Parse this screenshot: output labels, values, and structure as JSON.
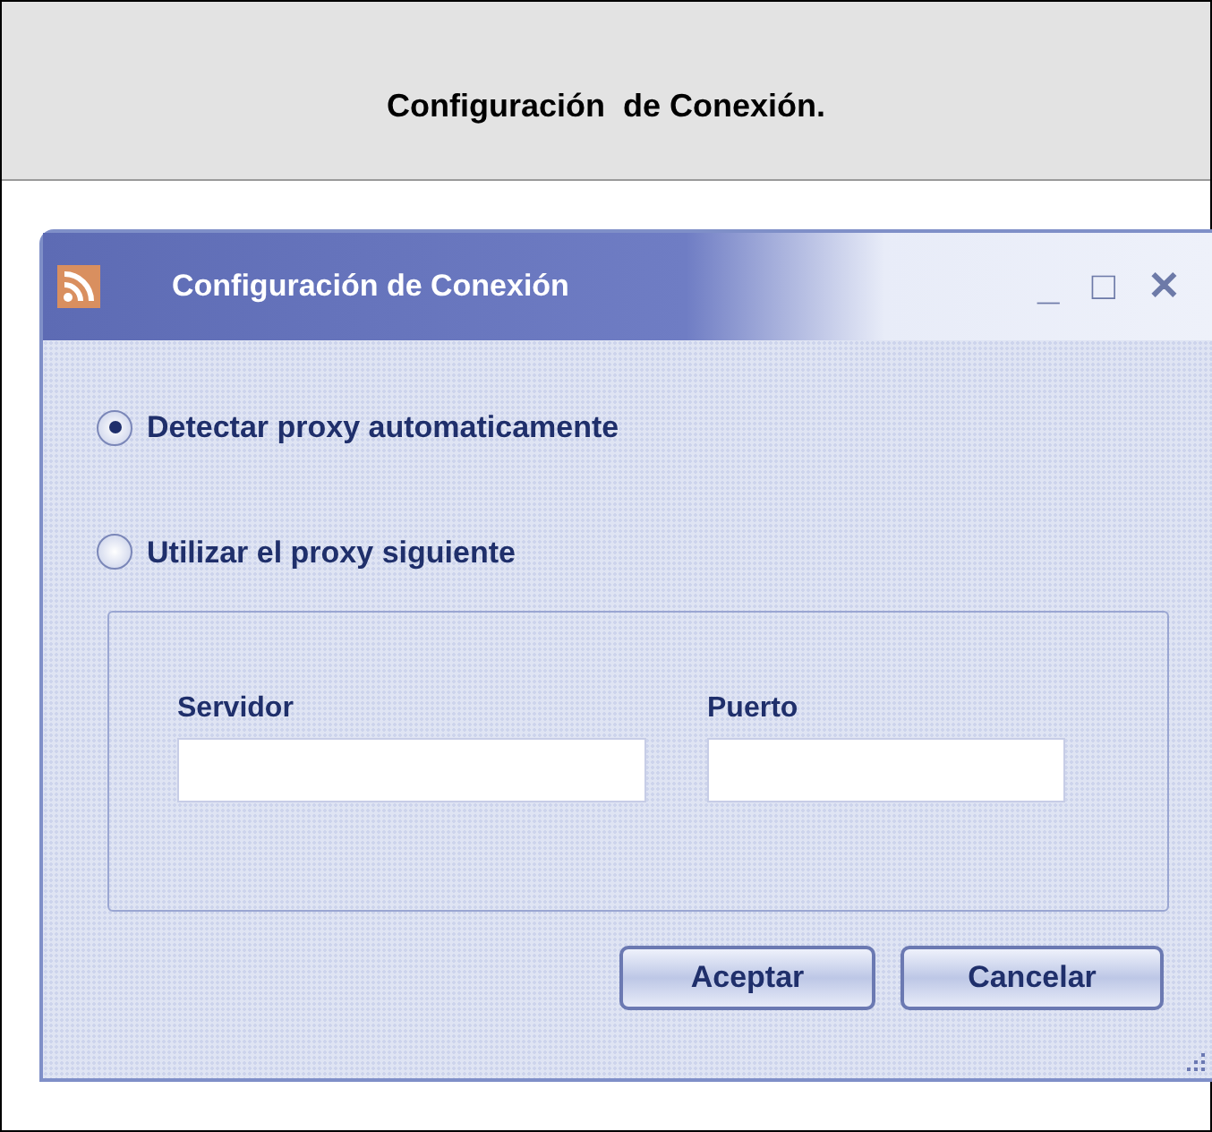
{
  "heading": "Configuración  de Conexión.",
  "window": {
    "title": "Configuración de Conexión",
    "controls": [
      "_",
      "□",
      "✕"
    ]
  },
  "options": [
    {
      "label": "Detectar proxy automaticamente",
      "selected": true
    },
    {
      "label": "Utilizar el proxy siguiente",
      "selected": false
    }
  ],
  "fields": [
    {
      "label": "Servidor"
    },
    {
      "label": "Puerto"
    }
  ],
  "buttons": [
    "Aceptar",
    "Cancelar"
  ]
}
